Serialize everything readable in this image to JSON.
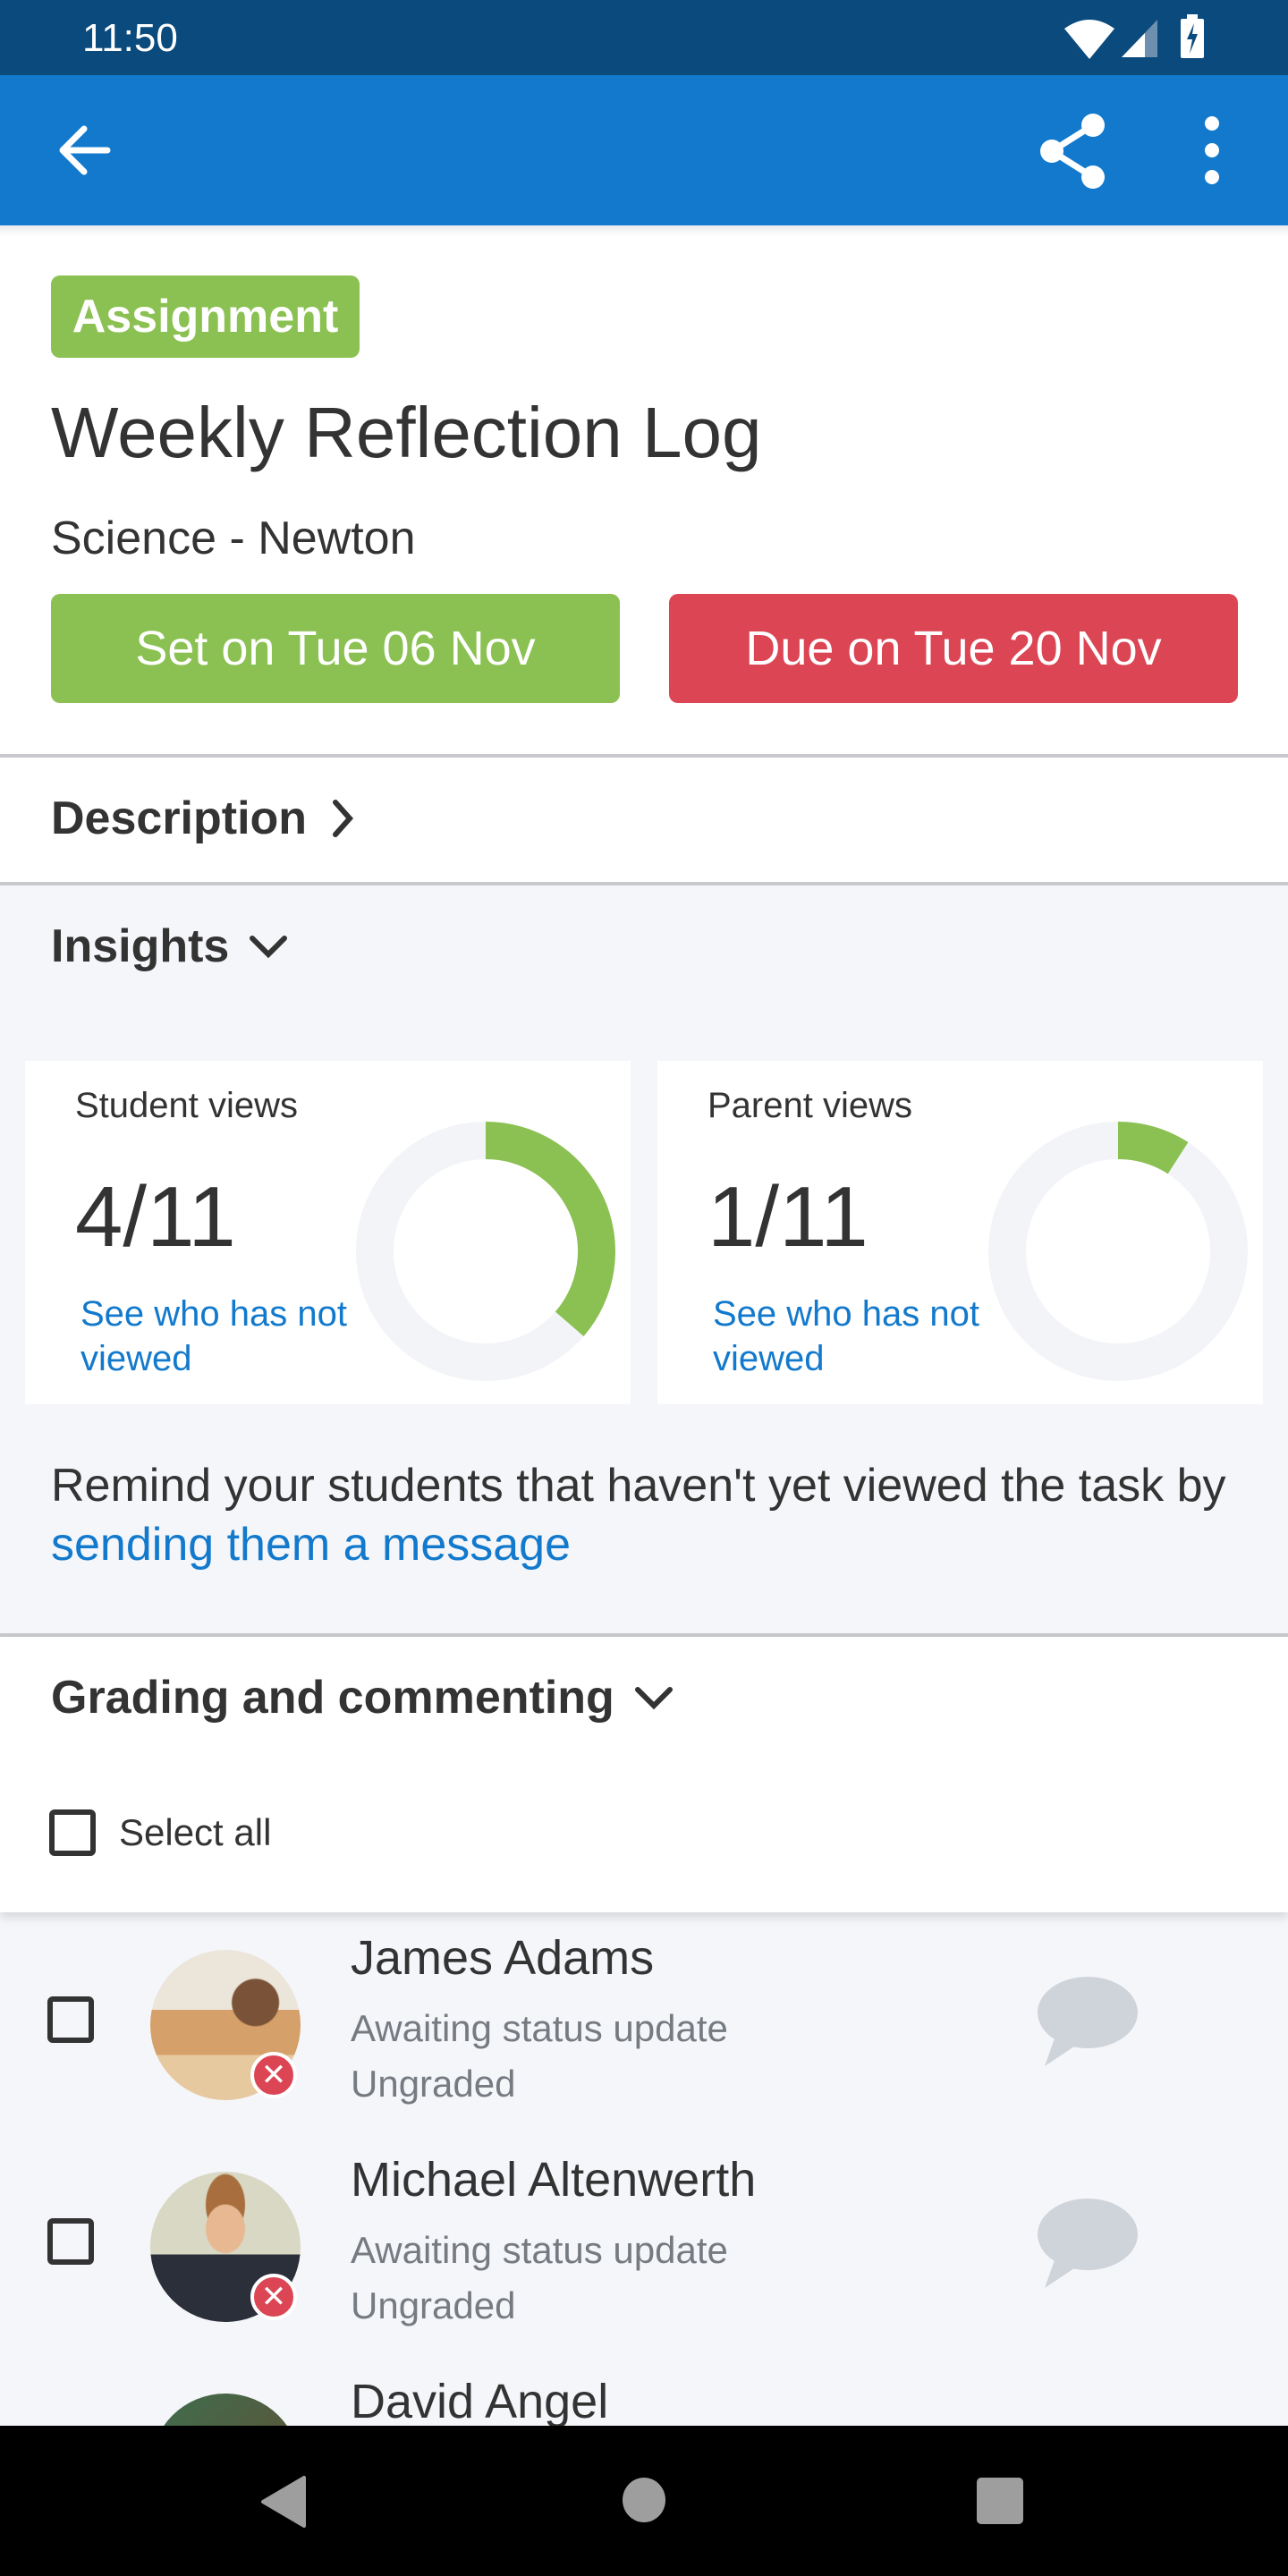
{
  "status_bar": {
    "time": "11:50",
    "icons": [
      "wifi-icon",
      "signal-icon",
      "battery-charging-icon"
    ]
  },
  "app_bar": {
    "icons": [
      "back-arrow-icon",
      "share-icon",
      "more-vertical-icon"
    ]
  },
  "assignment": {
    "type_badge": "Assignment",
    "title": "Weekly Reflection Log",
    "class": "Science - Newton",
    "set_label": "Set on Tue 06 Nov",
    "due_label": "Due on Tue 20 Nov"
  },
  "sections": {
    "description": "Description",
    "insights": "Insights",
    "grading": "Grading and commenting"
  },
  "insights": {
    "cards": [
      {
        "label": "Student views",
        "value": "4/11",
        "viewed": 4,
        "total": 11,
        "link": "See who has not viewed"
      },
      {
        "label": "Parent views",
        "value": "1/11",
        "viewed": 1,
        "total": 11,
        "link": "See who has not viewed"
      }
    ],
    "remind_text": "Remind your students that haven't yet viewed the task by ",
    "remind_link": "sending them a message"
  },
  "grading": {
    "select_all": "Select all",
    "students": [
      {
        "name": "James Adams",
        "status": "Awaiting status update",
        "grade": "Ungraded"
      },
      {
        "name": "Michael Altenwerth",
        "status": "Awaiting status update",
        "grade": "Ungraded"
      },
      {
        "name": "David Angel",
        "status": "",
        "grade": ""
      }
    ]
  },
  "colors": {
    "primary": "#1279cc",
    "status_bar": "#0b4a7c",
    "green": "#8bc152",
    "red": "#db4554",
    "background": "#f5f6fa",
    "ring_track": "#f3f4f8"
  }
}
